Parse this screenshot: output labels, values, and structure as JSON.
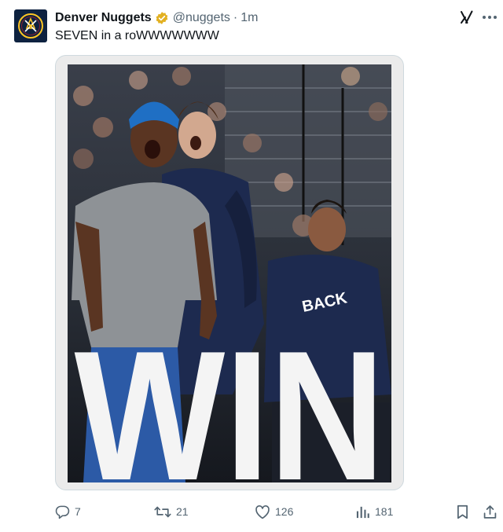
{
  "author": {
    "display_name": "Denver Nuggets",
    "handle": "@nuggets",
    "separator": "·",
    "timestamp": "1m",
    "verified_color": "#e2b021"
  },
  "tweet": {
    "text": "SEVEN in a roWWWWWWW"
  },
  "media": {
    "overlay_text": "WIN",
    "accent_colors": {
      "jersey_navy": "#1d2a4f",
      "beanie_blue": "#1f6fc4",
      "jeans_blue": "#2c5aa6",
      "shirt_gray": "#8e9296"
    }
  },
  "actions": {
    "replies": "7",
    "reposts": "21",
    "likes": "126",
    "views": "181"
  },
  "icons": {
    "avatar": "nuggets-logo-icon",
    "verified": "verified-badge-icon",
    "grok": "grok-icon",
    "more": "more-options-icon",
    "reply": "reply-icon",
    "repost": "repost-icon",
    "like": "heart-icon",
    "views": "views-chart-icon",
    "bookmark": "bookmark-icon",
    "share": "share-icon"
  },
  "colors": {
    "text_primary": "#0f1419",
    "text_secondary": "#536471",
    "border": "#cfd9de"
  }
}
